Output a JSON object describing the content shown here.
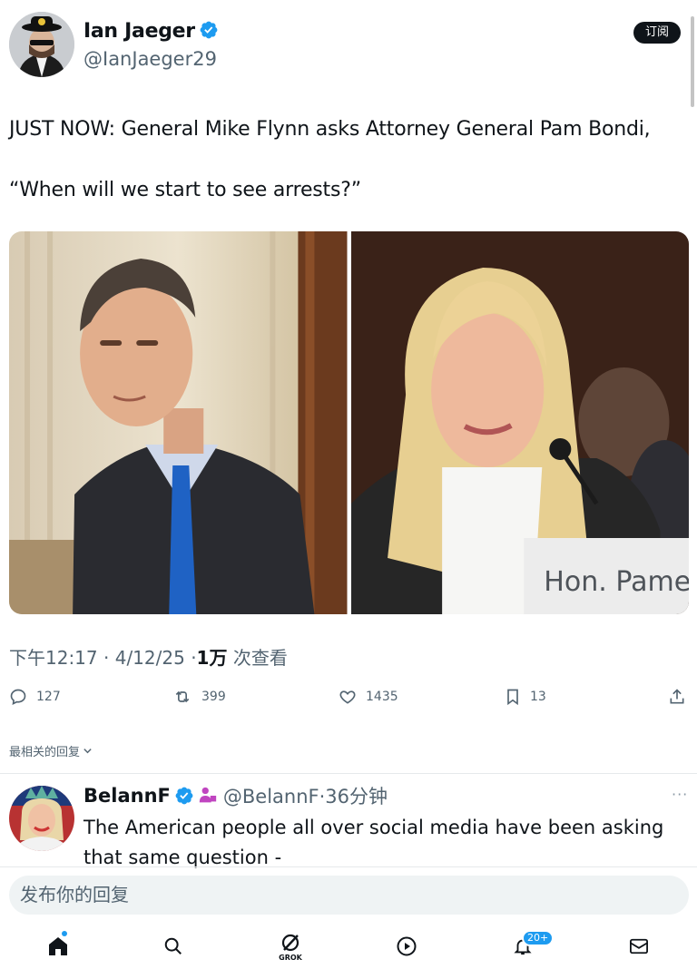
{
  "post": {
    "author_name": "Ian Jaeger",
    "author_handle": "@IanJaeger29",
    "subscribe_label": "订阅",
    "text_line1": "JUST NOW: General Mike Flynn asks Attorney General Pam Bondi,",
    "text_line2": "“When will we start to see arrests?”",
    "image_caption_sign": "Hon. Pamela J",
    "time": "下午12:17",
    "date": "4/12/25",
    "views_count": "1万",
    "views_label": "次查看",
    "replies": "127",
    "reposts": "399",
    "likes": "1435",
    "bookmarks": "13"
  },
  "sort_label": "最相关的回复",
  "reply": {
    "name": "BelannF",
    "handle_time": "@BelannF·36分钟",
    "more": "···",
    "text": "The American people all over social media have been asking that same question -"
  },
  "compose_placeholder": "发布你的回复",
  "nav": {
    "grok_label": "GROK",
    "notifications_badge": "20+"
  },
  "colors": {
    "accent": "#1d9bf0",
    "text": "#0f1419",
    "muted": "#536471"
  }
}
